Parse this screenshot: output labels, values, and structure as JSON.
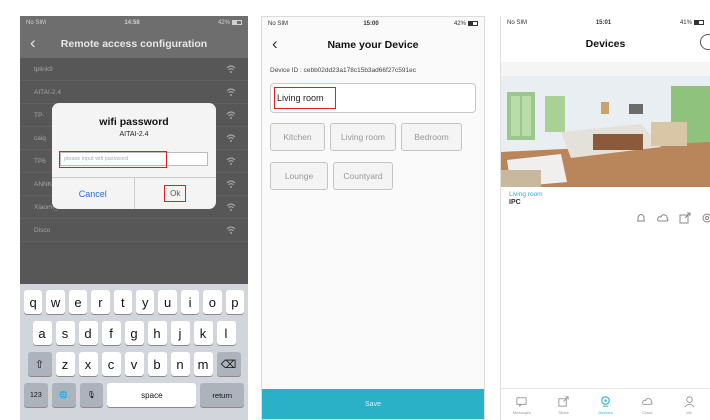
{
  "phone1": {
    "status": {
      "carrier": "No SIM",
      "time": "14:58",
      "battery": "42%"
    },
    "title": "Remote access configuration",
    "networks": [
      "tplink9",
      "AITAI-2.4",
      "TP-",
      "caiq",
      "TP6",
      "ANNKE",
      "Xiaomi_2012-",
      "Disco"
    ],
    "dialog": {
      "title": "wifi password",
      "ssid": "AITAI-2.4",
      "placeholder": "please input wifi password",
      "cancel": "Cancel",
      "ok": "Ok"
    },
    "keyboard": {
      "row1": [
        "q",
        "w",
        "e",
        "r",
        "t",
        "y",
        "u",
        "i",
        "o",
        "p"
      ],
      "row2": [
        "a",
        "s",
        "d",
        "f",
        "g",
        "h",
        "j",
        "k",
        "l"
      ],
      "row3": [
        "z",
        "x",
        "c",
        "v",
        "b",
        "n",
        "m"
      ],
      "shift": "⇧",
      "delete": "⌫",
      "numbers": "123",
      "globe": "🌐",
      "mic": "🎙",
      "space": "space",
      "return": "return"
    }
  },
  "phone2": {
    "status": {
      "carrier": "No SIM",
      "time": "15:00",
      "battery": "42%"
    },
    "title": "Name your Device",
    "device_id": "Device ID : cebb02dd23a178c15b3ad66f27c591ec",
    "name_value": "Living room",
    "suggestions": [
      "Kitchen",
      "Living room",
      "Bedroom",
      "Lounge",
      "Countyard"
    ],
    "save": "Save"
  },
  "phone3": {
    "status": {
      "carrier": "No SIM",
      "time": "15:01",
      "battery": "41%"
    },
    "title": "Devices",
    "device": {
      "name": "Living room",
      "type": "IPC"
    },
    "tabs": [
      "Messages",
      "Share",
      "Devices",
      "Cloud",
      "Me"
    ],
    "active_tab": "Devices",
    "colors": {
      "accent": "#2ab1c8",
      "highlight": "#e02020"
    }
  }
}
